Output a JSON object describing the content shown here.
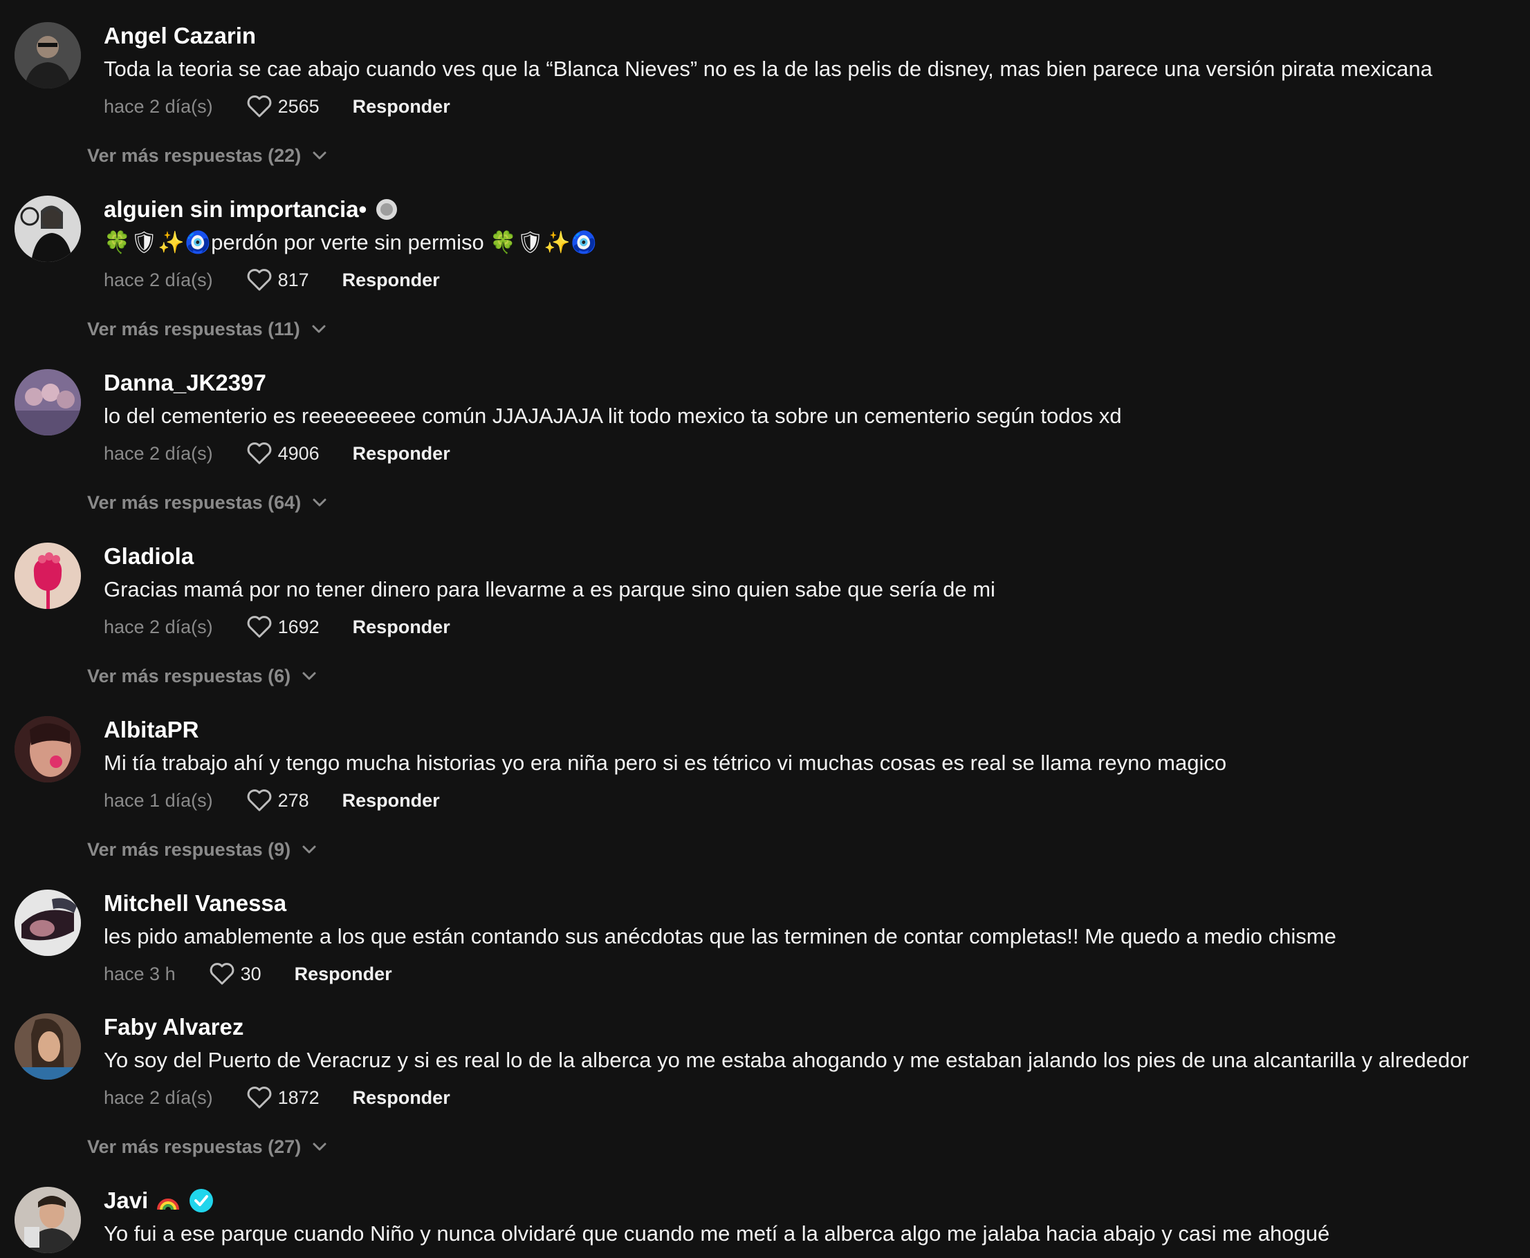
{
  "comments": [
    {
      "username": "Angel Cazarin",
      "text": "Toda la teoria se cae abajo cuando ves que la “Blanca Nieves” no es la de las pelis de disney, mas bien parece una versión pirata mexicana",
      "time": "hace 2 día(s)",
      "likes": "2565",
      "reply_label": "Responder",
      "more_replies": "Ver más respuestas (22)",
      "avatar_color": "#4a4a4a"
    },
    {
      "username": "alguien sin importancia•",
      "text": "🍀🛡✨🧿perdón por verte sin permiso 🍀🛡✨🧿",
      "time": "hace 2 día(s)",
      "likes": "817",
      "reply_label": "Responder",
      "more_replies": "Ver más respuestas (11)",
      "avatar_color": "#d8d8d8"
    },
    {
      "username": "Danna_JK2397",
      "text": "lo del cementerio es reeeeeeeee común JJAJAJAJA lit todo mexico ta sobre un cementerio según todos xd",
      "time": "hace 2 día(s)",
      "likes": "4906",
      "reply_label": "Responder",
      "more_replies": "Ver más respuestas (64)",
      "avatar_color": "#7d6c93"
    },
    {
      "username": "Gladiola",
      "text": "Gracias mamá por no tener dinero para llevarme a es parque sino quien sabe que sería de mi",
      "time": "hace 2 día(s)",
      "likes": "1692",
      "reply_label": "Responder",
      "more_replies": "Ver más respuestas (6)",
      "avatar_color": "#e7cfc0"
    },
    {
      "username": "AlbitaPR",
      "text": "Mi tía trabajo ahí y tengo mucha historias yo era niña pero si es tétrico vi muchas cosas es real se llama reyno magico",
      "time": "hace 1 día(s)",
      "likes": "278",
      "reply_label": "Responder",
      "more_replies": "Ver más respuestas (9)",
      "avatar_color": "#8a3c3c"
    },
    {
      "username": "Mitchell Vanessa",
      "text": "les pido amablemente a los que están contando sus anécdotas que las terminen de contar completas!! Me quedo a medio chisme",
      "time": "hace 3 h",
      "likes": "30",
      "reply_label": "Responder",
      "more_replies": "",
      "avatar_color": "#5a4a55"
    },
    {
      "username": "Faby Alvarez",
      "text": "Yo soy del Puerto de Veracruz y si es real lo de la alberca yo me estaba ahogando y me estaban jalando los pies de una alcantarilla y alrededor",
      "time": "hace 2 día(s)",
      "likes": "1872",
      "reply_label": "Responder",
      "more_replies": "Ver más respuestas (27)",
      "avatar_color": "#6b5446"
    },
    {
      "username": "Javi",
      "text": "Yo fui a ese parque cuando Niño y nunca olvidaré que cuando me metí a la alberca algo me jalaba hacia abajo y casi me ahogué",
      "time": "",
      "likes": "",
      "reply_label": "",
      "more_replies": "",
      "avatar_color": "#c9c2bb"
    }
  ],
  "colors": {
    "background": "#121212",
    "muted": "#8a8a8a",
    "verified": "#20d5ec"
  },
  "icons": {
    "like": "heart-outline-icon",
    "expand": "chevron-down-icon",
    "verified": "verified-badge-icon",
    "rainbow": "rainbow-emoji",
    "status": "grey-circle-emoji"
  }
}
